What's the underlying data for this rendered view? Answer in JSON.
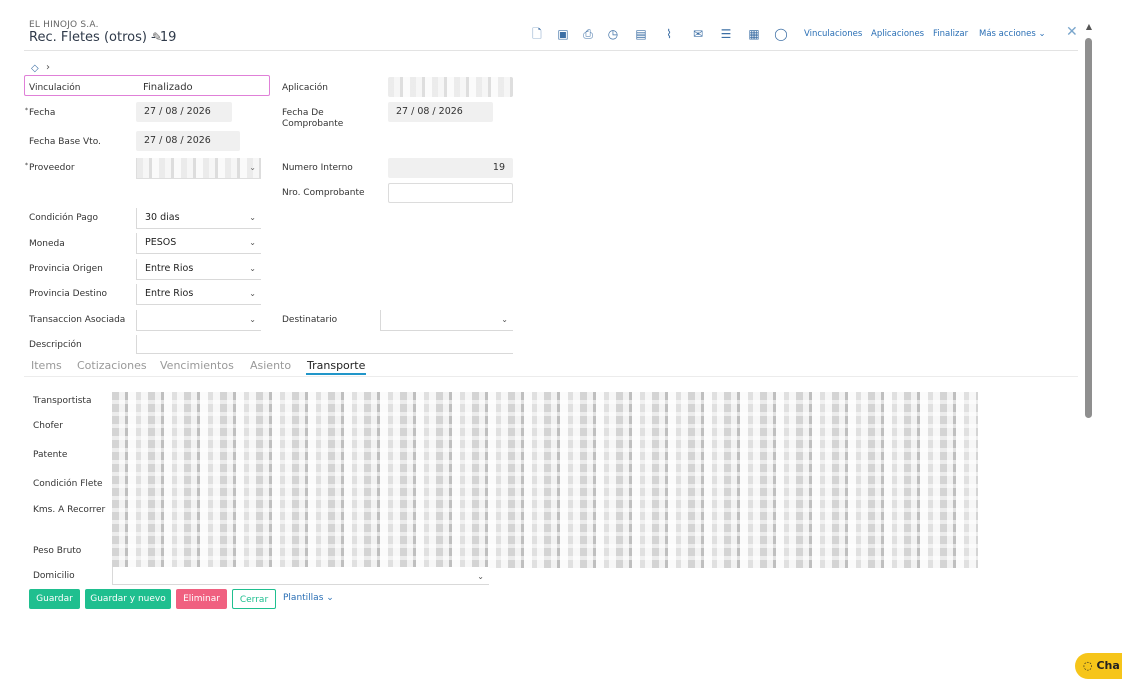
{
  "header": {
    "company": "EL HINOJO S.A.",
    "title": "Rec. Fletes (otros) - 19",
    "links": [
      "Vinculaciones",
      "Aplicaciones",
      "Finalizar",
      "Más acciones"
    ]
  },
  "form": {
    "vinculacion_label": "Vinculación",
    "vinculacion_value": "Finalizado",
    "aplicacion_label": "Aplicación",
    "fecha_label": "Fecha",
    "fecha_value": "27 / 08 / 2026",
    "fecha_comprobante_label_1": "Fecha De",
    "fecha_comprobante_label_2": "Comprobante",
    "fecha_comprobante_value": "27 / 08 / 2026",
    "fecha_base_label": "Fecha Base Vto.",
    "fecha_base_value": "27 / 08 / 2026",
    "proveedor_label": "Proveedor",
    "numero_interno_label": "Numero Interno",
    "numero_interno_value": "19",
    "nro_comprobante_label": "Nro. Comprobante",
    "condicion_pago_label": "Condición Pago",
    "condicion_pago_value": "30 dias",
    "moneda_label": "Moneda",
    "moneda_value": "PESOS",
    "provincia_origen_label": "Provincia Origen",
    "provincia_origen_value": "Entre Rios",
    "provincia_destino_label": "Provincia Destino",
    "provincia_destino_value": "Entre Rios",
    "transaccion_label": "Transaccion Asociada",
    "destinatario_label": "Destinatario",
    "descripcion_label": "Descripción"
  },
  "tabs": [
    "Items",
    "Cotizaciones",
    "Vencimientos",
    "Asiento",
    "Transporte"
  ],
  "transporte": {
    "labels": [
      "Transportista",
      "Chofer",
      "Patente",
      "Condición Flete",
      "Kms. A Recorrer",
      "Peso Bruto",
      "Domicilio"
    ]
  },
  "buttons": {
    "guardar": "Guardar",
    "guardar_nuevo": "Guardar y nuevo",
    "eliminar": "Eliminar",
    "cerrar": "Cerrar",
    "plantillas": "Plantillas"
  },
  "chat": {
    "label": "Cha"
  },
  "colors": {
    "accent": "#2196c9",
    "primary_button": "#1fbf8f",
    "danger_button": "#f06080",
    "highlight_border": "#e080d8",
    "chat": "#f6c51a"
  }
}
